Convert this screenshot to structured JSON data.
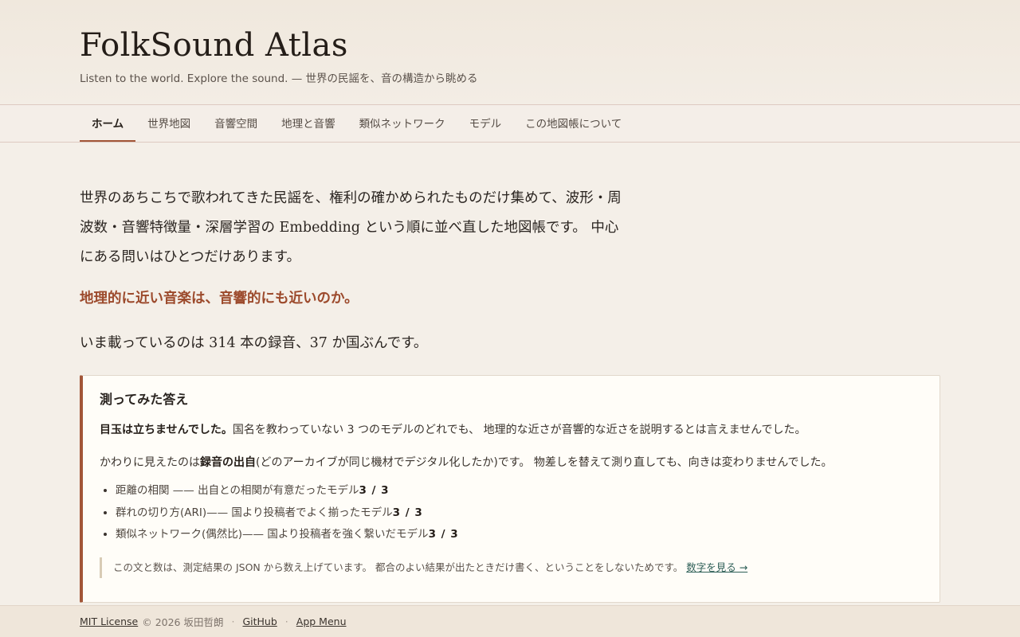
{
  "header": {
    "title": "FolkSound Atlas",
    "tagline": "Listen to the world. Explore the sound. — 世界の民謡を、音の構造から眺める"
  },
  "nav": {
    "tabs": [
      {
        "label": "ホーム",
        "active": true
      },
      {
        "label": "世界地図"
      },
      {
        "label": "音響空間"
      },
      {
        "label": "地理と音響"
      },
      {
        "label": "類似ネットワーク"
      },
      {
        "label": "モデル"
      },
      {
        "label": "この地図帳について"
      }
    ]
  },
  "main": {
    "intro": "世界のあちこちで歌われてきた民謡を、権利の確かめられたものだけ集めて、波形・周波数・音響特徴量・深層学習の Embedding という順に並べ直した地図帳です。 中心にある問いはひとつだけあります。",
    "question": "地理的に近い音楽は、音響的にも近いのか。",
    "count_line": "いま載っているのは 314 本の録音、37 か国ぶんです。",
    "answer": {
      "title": "測ってみた答え",
      "lead_bold": "目玉は立ちませんでした。",
      "lead_rest": "国名を教わっていない 3 つのモデルのどれでも、 地理的な近さが音響的な近さを説明するとは言えませんでした。",
      "second_pre": "かわりに見えたのは",
      "second_bold": "録音の出自",
      "second_post": "(どのアーカイブが同じ機材でデジタル化したか)です。 物差しを替えて測り直しても、向きは変わりませんでした。",
      "findings": [
        {
          "text": "距離の相関 —— 出自との相関が有意だったモデル",
          "ratio": "3 / 3"
        },
        {
          "text": "群れの切り方(ARI)—— 国より投稿者でよく揃ったモデル",
          "ratio": "3 / 3"
        },
        {
          "text": "類似ネットワーク(偶然比)—— 国より投稿者を強く繋いだモデル",
          "ratio": "3 / 3"
        }
      ],
      "note": "この文と数は、測定結果の JSON から数え上げています。 都合のよい結果が出たときだけ書く、ということをしないためです。",
      "note_link": "数字を見る →"
    }
  },
  "footer": {
    "license": "MIT License",
    "copyright": "© 2026 坂田哲朗",
    "github": "GitHub",
    "app_menu": "App Menu",
    "separator": "·"
  },
  "colors": {
    "accent": "#a25638",
    "question": "#9c4a2c",
    "link": "#2e5f57",
    "background": "#f4efe8"
  }
}
